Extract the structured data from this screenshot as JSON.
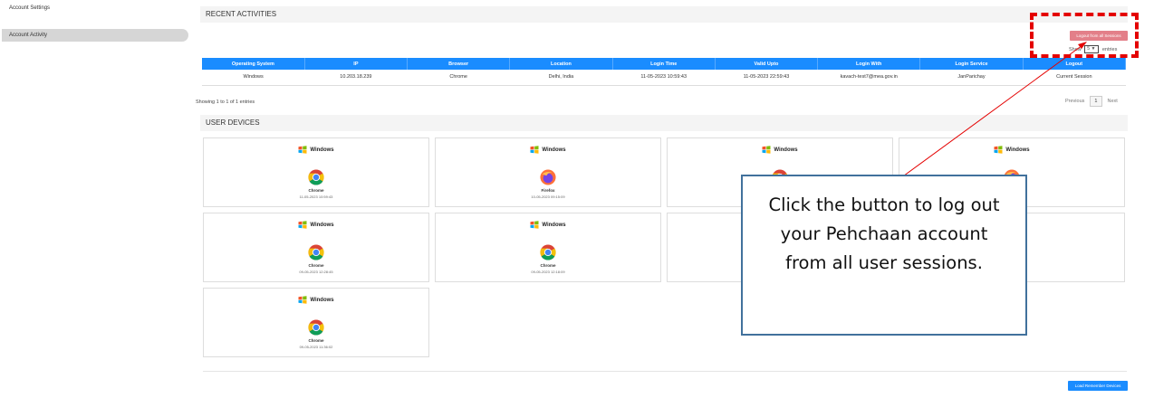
{
  "sidebar": {
    "items": [
      {
        "label": "Account Settings",
        "active": false
      },
      {
        "label": "Account Activity",
        "active": true
      }
    ]
  },
  "recent_activities": {
    "title": "RECENT ACTIVITIES",
    "logout_all_label": "Logout from all Sessions",
    "show_label": "Show",
    "entries_select_value": "5",
    "entries_label": "entries",
    "table": {
      "headers": [
        "Operating System",
        "IP",
        "Browser",
        "Location",
        "Login Time",
        "Valid Upto",
        "Login With",
        "Login Service",
        "Logout"
      ],
      "rows": [
        [
          "Windows",
          "10.203.18.239",
          "Chrome",
          "Delhi, India",
          "11-05-2023 10:59:43",
          "11-05-2023 22:59:43",
          "kavach-test7@mea.gov.in",
          "JanParichay",
          "Current Session"
        ]
      ]
    },
    "showing_text": "Showing 1 to 1 of 1 entries",
    "pagination": {
      "previous": "Previous",
      "page": "1",
      "next": "Next"
    }
  },
  "user_devices": {
    "title": "USER DEVICES",
    "cards": [
      {
        "os": "Windows",
        "browser": "Chrome",
        "time": "11-05-2023 10:59:43",
        "icon": "chrome-icon"
      },
      {
        "os": "Windows",
        "browser": "Firefox",
        "time": "10-05-2023 09:15:09",
        "icon": "firefox-icon"
      },
      {
        "os": "Windows",
        "browser": "",
        "time": "",
        "icon": "chrome-icon"
      },
      {
        "os": "Windows",
        "browser": "",
        "time": "",
        "icon": "firefox-icon"
      },
      {
        "os": "Windows",
        "browser": "Chrome",
        "time": "09-05-2023 12:28:45",
        "icon": "chrome-icon"
      },
      {
        "os": "Windows",
        "browser": "Chrome",
        "time": "09-05-2023 12:18:09",
        "icon": "chrome-icon"
      },
      {
        "os": "",
        "browser": "",
        "time": "",
        "icon": ""
      },
      {
        "os": "ws",
        "browser": "",
        "time": "",
        "icon": ""
      },
      {
        "os": "Windows",
        "browser": "Chrome",
        "time": "09-05-2023 11:36:02",
        "icon": "chrome-icon"
      }
    ],
    "load_button_label": "Load Remember Devices"
  },
  "annotation": {
    "callout_text": "Click the button to log out your Pehchaan account from all user sessions.",
    "highlight_color": "#e40000",
    "arrow_color": "#e40000",
    "callout_border_color": "#41719c"
  },
  "colors": {
    "primary_blue": "#1a8cff",
    "logout_pink": "#e37f89"
  }
}
